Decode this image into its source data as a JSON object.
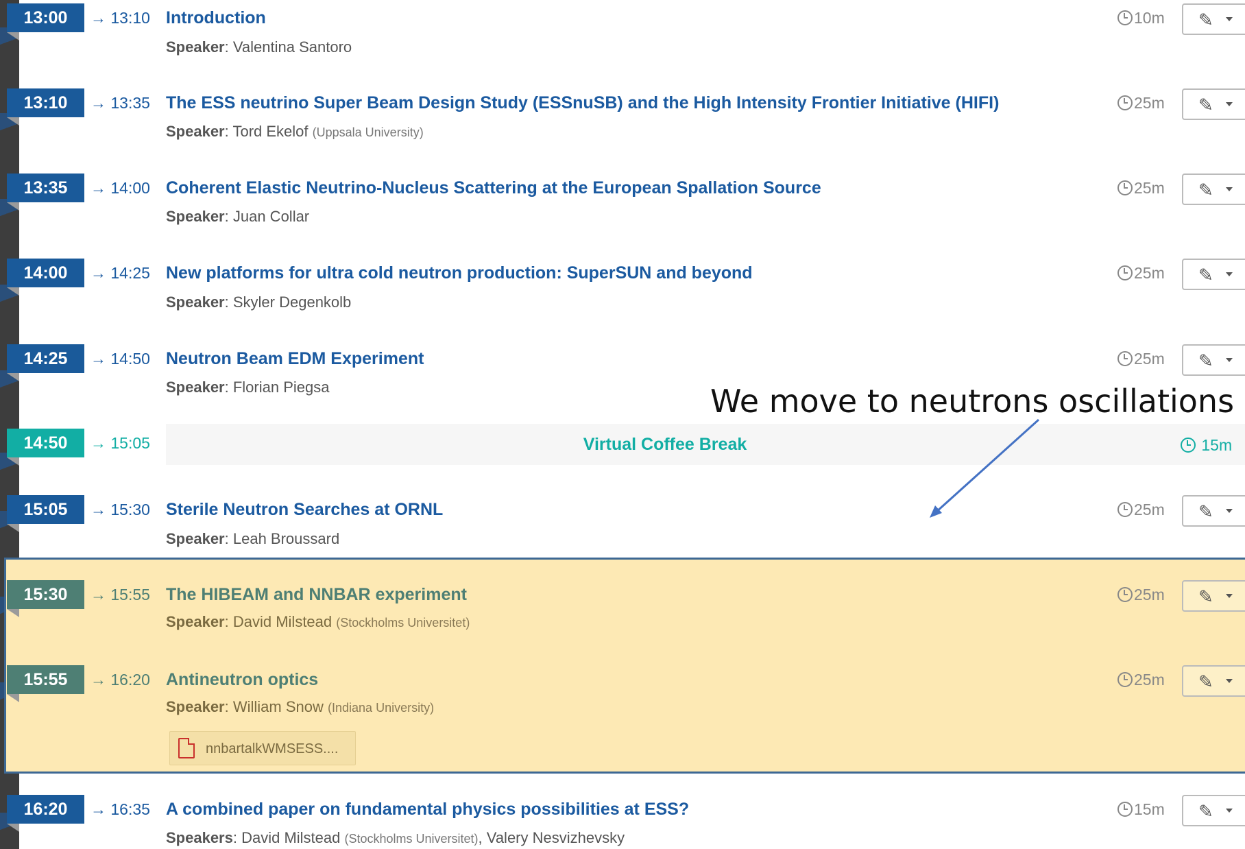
{
  "entries": [
    {
      "start": "13:00",
      "end": "→ 13:10",
      "title": "Introduction",
      "speaker_label": "Speaker",
      "speaker": "Valentina Santoro",
      "affiliation": "",
      "duration": "10m",
      "style": "blue"
    },
    {
      "start": "13:10",
      "end": "→ 13:35",
      "title": "The ESS neutrino Super Beam Design Study (ESSnuSB) and the High Intensity Frontier Initiative (HIFI)",
      "speaker_label": "Speaker",
      "speaker": "Tord Ekelof",
      "affiliation": "(Uppsala University)",
      "duration": "25m",
      "style": "blue"
    },
    {
      "start": "13:35",
      "end": "→ 14:00",
      "title": "Coherent Elastic Neutrino-Nucleus Scattering at the European Spallation Source",
      "speaker_label": "Speaker",
      "speaker": "Juan Collar",
      "affiliation": "",
      "duration": "25m",
      "style": "blue"
    },
    {
      "start": "14:00",
      "end": "→ 14:25",
      "title": "New platforms for ultra cold neutron production: SuperSUN and beyond",
      "speaker_label": "Speaker",
      "speaker": "Skyler Degenkolb",
      "affiliation": "",
      "duration": "25m",
      "style": "blue"
    },
    {
      "start": "14:25",
      "end": "→ 14:50",
      "title": "Neutron Beam EDM Experiment",
      "speaker_label": "Speaker",
      "speaker": "Florian Piegsa",
      "affiliation": "",
      "duration": "25m",
      "style": "blue"
    },
    {
      "start": "15:05",
      "end": "→ 15:30",
      "title": "Sterile Neutron Searches at ORNL",
      "speaker_label": "Speaker",
      "speaker": "Leah Broussard",
      "affiliation": "",
      "duration": "25m",
      "style": "blue"
    },
    {
      "start": "15:30",
      "end": "→ 15:55",
      "title": "The HIBEAM and NNBAR experiment",
      "speaker_label": "Speaker",
      "speaker": "David Milstead",
      "affiliation": "(Stockholms Universitet)",
      "duration": "25m",
      "style": "green"
    },
    {
      "start": "15:55",
      "end": "→ 16:20",
      "title": "Antineutron optics",
      "speaker_label": "Speaker",
      "speaker": "William Snow",
      "affiliation": "(Indiana University)",
      "duration": "25m",
      "style": "green"
    },
    {
      "start": "16:20",
      "end": "→ 16:35",
      "title": "A combined paper on fundamental physics possibilities at ESS?",
      "speaker_label": "Speakers",
      "speaker": "David Milstead",
      "affiliation": "(Stockholms Universitet)",
      "speaker2": "Valery Nesvizhevsky",
      "duration": "15m",
      "style": "blue"
    }
  ],
  "coffee_break": {
    "start": "14:50",
    "end": "→ 15:05",
    "title": "Virtual Coffee Break",
    "duration": "15m"
  },
  "attachment": {
    "name": "nnbartalkWMSESS...."
  },
  "annotation": {
    "text": "We move to  neutrons oscillations"
  },
  "icons": {
    "edit": "pencil-icon",
    "duration": "clock-icon",
    "attachment": "pdf-file-icon"
  },
  "colors": {
    "primary": "#1a5a9a",
    "break": "#12aea4",
    "highlight_bg": "#fde9b4",
    "highlight_border": "#3d6894"
  }
}
